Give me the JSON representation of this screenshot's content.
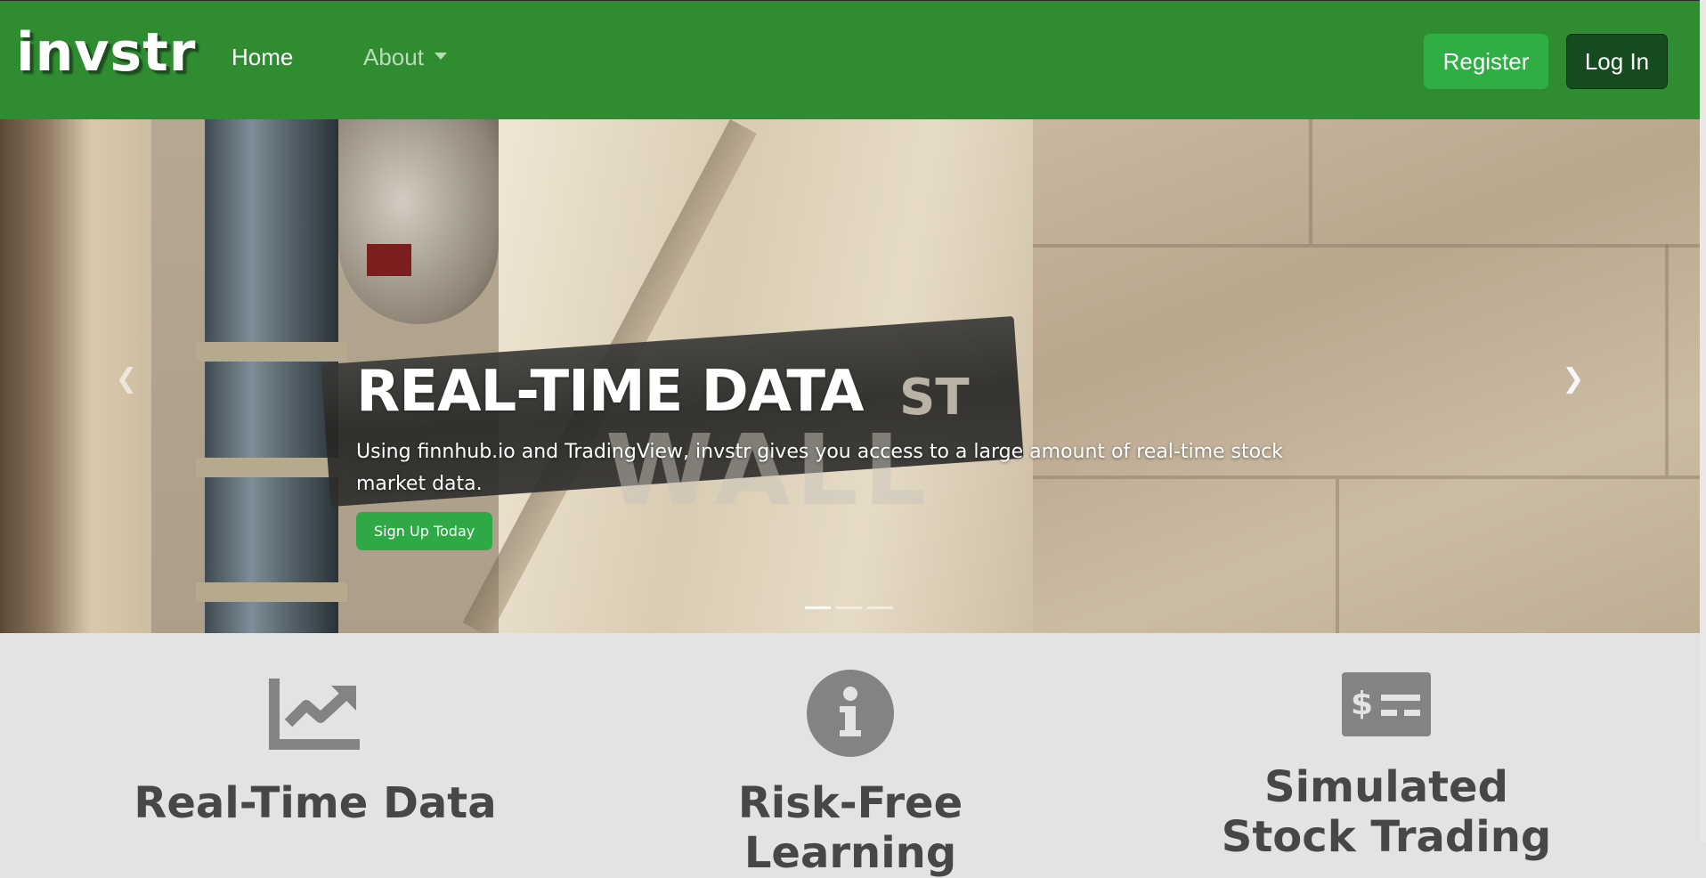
{
  "navbar": {
    "brand": "invstr",
    "links": [
      {
        "label": "Home"
      },
      {
        "label": "About"
      }
    ],
    "register_label": "Register",
    "login_label": "Log In"
  },
  "hero": {
    "slide": {
      "title": "REAL-TIME DATA",
      "text": "Using finnhub.io and TradingView, invstr gives you access to a large amount of real-time stock market data.",
      "cta_label": "Sign Up Today"
    },
    "prev_icon": "chevron-left-icon",
    "next_icon": "chevron-right-icon",
    "slide_count": 3,
    "active_slide": 1
  },
  "features": [
    {
      "icon": "chart-line-icon",
      "title": "Real-Time Data"
    },
    {
      "icon": "info-circle-icon",
      "title": "Risk-Free Learning"
    },
    {
      "icon": "money-check-dollar-icon",
      "title": "Simulated Stock Trading"
    }
  ],
  "colors": {
    "navbar": "#2f8c31",
    "register_button": "#2eae43",
    "login_button": "#154b1f",
    "signup_button": "#2fa946",
    "feature_icon": "#838383",
    "feature_heading": "#474747",
    "features_background": "#e3e3e3"
  }
}
